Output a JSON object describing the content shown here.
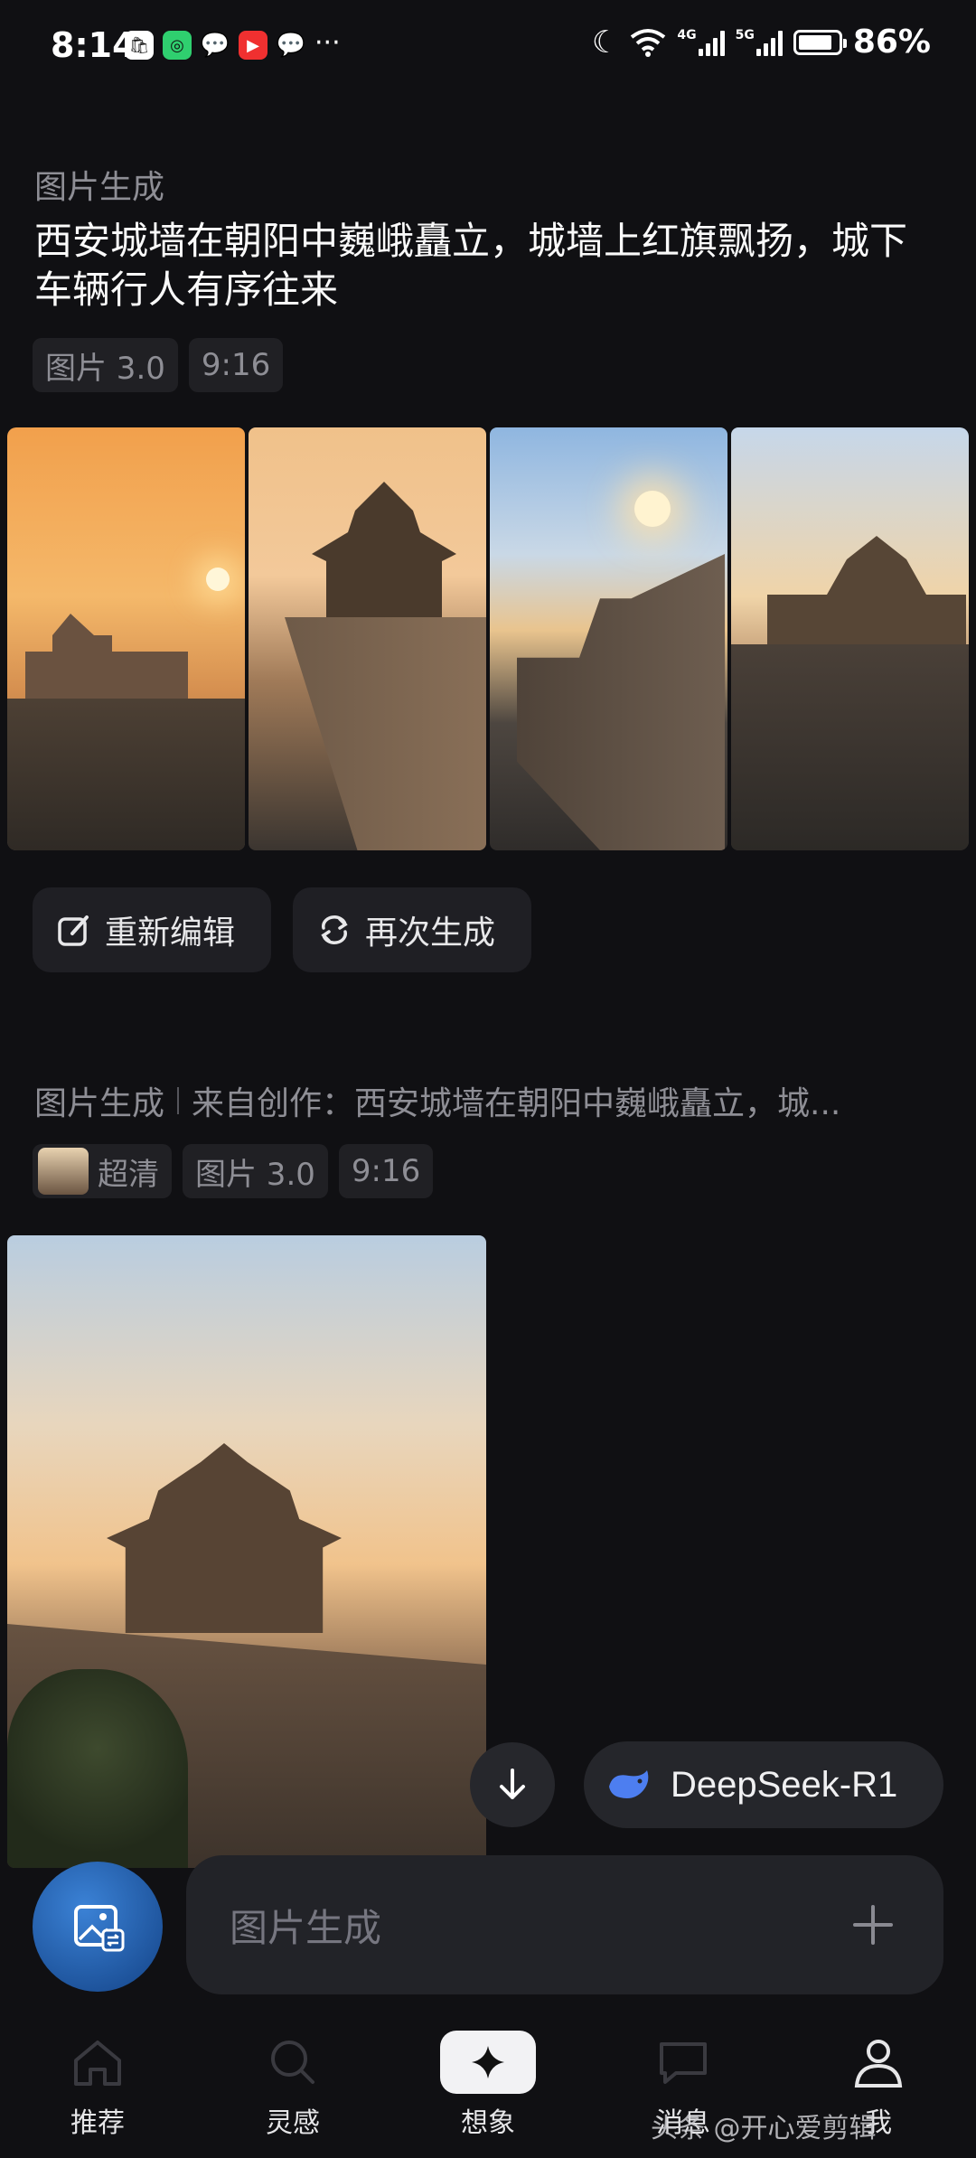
{
  "status_bar": {
    "time": "8:14",
    "net_a": "4G",
    "net_b": "5G",
    "battery": "86%",
    "battery_level": 0.86,
    "more": "···"
  },
  "first_block": {
    "section": "图片生成",
    "prompt": "西安城墙在朝阳中巍峨矗立，城墙上红旗飘扬，城下车辆行人有序往来",
    "chips": [
      "图片 3.0",
      "9:16"
    ]
  },
  "actions": {
    "edit": "重新编辑",
    "regenerate": "再次生成"
  },
  "second_block": {
    "section": "图片生成",
    "source": "来自创作：西安城墙在朝阳中巍峨矗立，城...",
    "quality": "超清",
    "chips": [
      "图片 3.0",
      "9:16"
    ]
  },
  "model": {
    "label": "DeepSeek-R1"
  },
  "input": {
    "placeholder": "图片生成"
  },
  "nav": [
    "推荐",
    "灵感",
    "想象",
    "消息",
    "我"
  ],
  "watermark": "头条 @开心爱剪辑"
}
